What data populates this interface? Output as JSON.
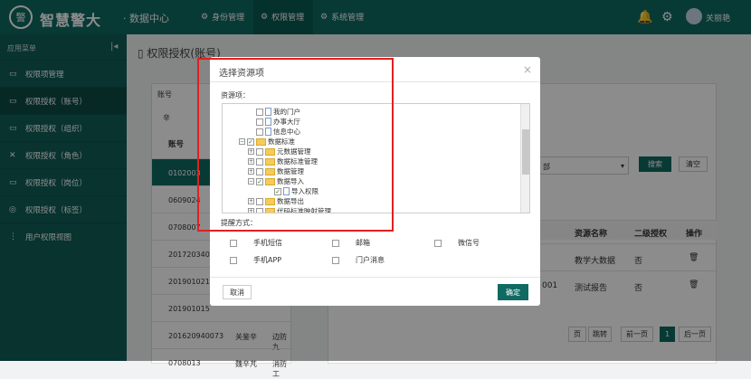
{
  "header": {
    "logo_text": "警",
    "brand": "智慧警大",
    "sub": "· 数据中心",
    "nav": [
      "身份管理",
      "权限管理",
      "系统管理"
    ],
    "user": "关丽艳"
  },
  "sidebar": {
    "title": "应用菜单",
    "items": [
      {
        "label": "权限项管理"
      },
      {
        "label": "权限授权（账号）"
      },
      {
        "label": "权限授权（组织）"
      },
      {
        "label": "权限授权（角色）"
      },
      {
        "label": "权限授权（岗位）"
      },
      {
        "label": "权限授权（标签）"
      },
      {
        "label": "用户权限视图"
      }
    ]
  },
  "main": {
    "title": "权限授权(账号)",
    "left_tab": "账号",
    "left_filter": "辛",
    "col_header": "账号",
    "accounts": [
      "0102003",
      "0609024",
      "0708007",
      "201720340",
      "201901021",
      "201901015",
      "201620940073",
      "0708013"
    ],
    "row_names": [
      "",
      "",
      "",
      "",
      "",
      "",
      "关鉴辛",
      "魏辛芃"
    ],
    "row_orgs": [
      "",
      "",
      "",
      "",
      "",
      "",
      "边防九",
      "消防工"
    ],
    "search_btn": "搜索",
    "clear_btn": "清空",
    "select_tail": "部",
    "table_headers": [
      "资源名称",
      "二级授权",
      "操作"
    ],
    "table_rows": [
      {
        "name": "教学大数据",
        "second": "否"
      },
      {
        "name": "测试报告",
        "second": "否",
        "prefix": "001"
      }
    ],
    "pager": {
      "unit": "页",
      "jump": "跳转",
      "prev": "前一页",
      "current": "1",
      "next": "后一页"
    }
  },
  "dialog": {
    "title": "选择资源项",
    "resource_label": "资源项：",
    "tree": [
      {
        "label": "我的门户",
        "level": 1,
        "checked": false,
        "type": "doc",
        "expander": false
      },
      {
        "label": "办事大厅",
        "level": 1,
        "checked": false,
        "type": "doc",
        "expander": false
      },
      {
        "label": "信息中心",
        "level": 1,
        "checked": false,
        "type": "doc",
        "expander": false
      },
      {
        "label": "数据标准",
        "level": 0,
        "checked": true,
        "type": "folder",
        "expander": "−"
      },
      {
        "label": "元数据管理",
        "level": 1,
        "checked": false,
        "type": "folder",
        "expander": "+"
      },
      {
        "label": "数据标准管理",
        "level": 1,
        "checked": false,
        "type": "folder",
        "expander": "+"
      },
      {
        "label": "数据管理",
        "level": 1,
        "checked": false,
        "type": "folder",
        "expander": "+"
      },
      {
        "label": "数据导入",
        "level": 1,
        "checked": true,
        "type": "folder",
        "expander": "−"
      },
      {
        "label": "导入权限",
        "level": 2,
        "checked": true,
        "type": "doc",
        "expander": false
      },
      {
        "label": "数据导出",
        "level": 1,
        "checked": false,
        "type": "folder",
        "expander": "+"
      },
      {
        "label": "代码标准映射管理",
        "level": 1,
        "checked": false,
        "type": "folder",
        "expander": "+"
      }
    ],
    "remind_label": "提醒方式：",
    "options": [
      "手机短信",
      "邮箱",
      "微信号",
      "手机APP",
      "门户消息"
    ],
    "cancel": "取消",
    "confirm": "确定"
  }
}
